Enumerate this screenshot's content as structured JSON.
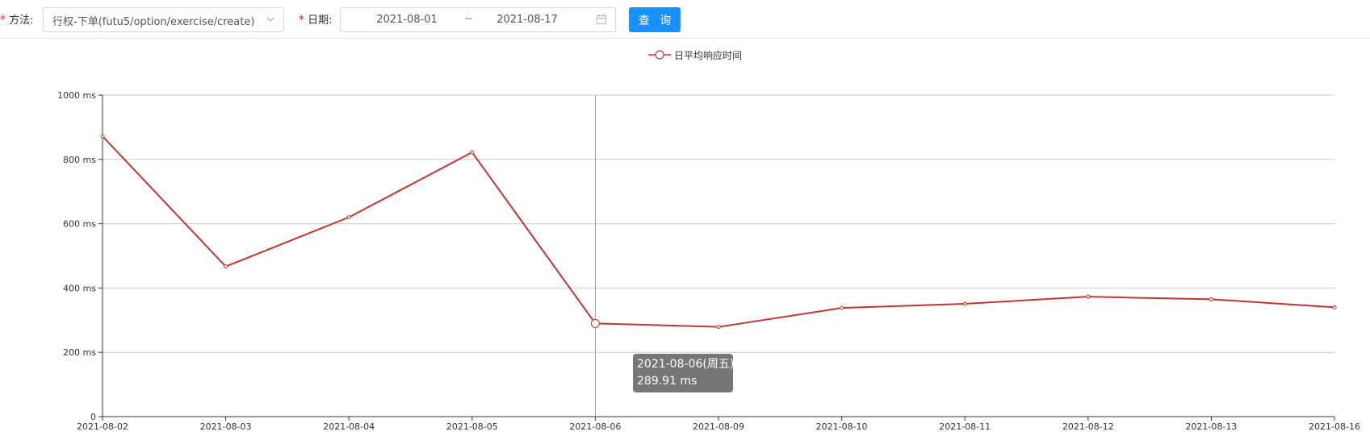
{
  "toolbar": {
    "method_label": "方法:",
    "method_value": "行权-下单(futu5/option/exercise/create)",
    "date_label": "日期:",
    "start_date": "2021-08-01",
    "range_separator": "~",
    "end_date": "2021-08-17",
    "query_button": "查 询",
    "required_mark": "*"
  },
  "legend": {
    "label": "日平均响应时间"
  },
  "tooltip": {
    "date": "2021-08-06(周五)",
    "value": "289.91 ms"
  },
  "colors": {
    "line": "#c23531",
    "primary": "#1890ff",
    "required": "#f5222d",
    "grid": "#cccccc"
  },
  "icons": {
    "select_arrow": "chevron-down-icon",
    "date_picker": "calendar-icon",
    "legend_marker": "circle-line-icon"
  },
  "chart_data": {
    "type": "line",
    "categories": [
      "2021-08-02",
      "2021-08-03",
      "2021-08-04",
      "2021-08-05",
      "2021-08-06",
      "2021-08-09",
      "2021-08-10",
      "2021-08-11",
      "2021-08-12",
      "2021-08-13",
      "2021-08-16"
    ],
    "series": [
      {
        "name": "日平均响应时间",
        "values": [
          872,
          467,
          620,
          822,
          289.91,
          279,
          338,
          351,
          373,
          365,
          340
        ]
      }
    ],
    "ylim": [
      0,
      1000
    ],
    "yticks": [
      0,
      200,
      400,
      600,
      800,
      1000
    ],
    "ytick_labels": [
      "0",
      "200 ms",
      "400 ms",
      "600 ms",
      "800 ms",
      "1000 ms"
    ],
    "highlight_category": "2021-08-06",
    "grid": true,
    "legend_position": "top-center"
  }
}
